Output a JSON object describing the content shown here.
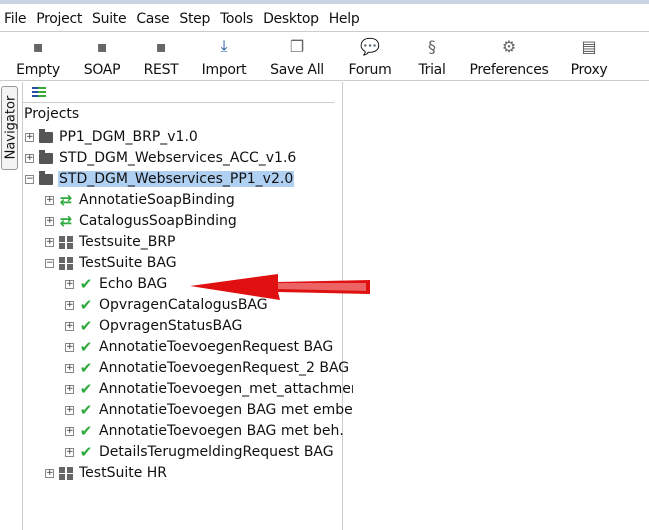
{
  "menu": [
    "File",
    "Project",
    "Suite",
    "Case",
    "Step",
    "Tools",
    "Desktop",
    "Help"
  ],
  "toolbar": [
    {
      "label": "Empty",
      "icon": "empty-project-icon"
    },
    {
      "label": "SOAP",
      "icon": "soap-icon"
    },
    {
      "label": "REST",
      "icon": "rest-icon"
    },
    {
      "label": "Import",
      "icon": "import-icon"
    },
    {
      "label": "Save All",
      "icon": "save-all-icon"
    },
    {
      "label": "Forum",
      "icon": "forum-icon"
    },
    {
      "label": "Trial",
      "icon": "trial-icon"
    },
    {
      "label": "Preferences",
      "icon": "gear-icon"
    },
    {
      "label": "Proxy",
      "icon": "proxy-icon"
    }
  ],
  "navigator": {
    "tab": "Navigator",
    "title": "Projects"
  },
  "tree": [
    {
      "label": "PP1_DGM_BRP_v1.0",
      "level": 0,
      "type": "project",
      "expanded": false
    },
    {
      "label": "STD_DGM_Webservices_ACC_v1.6",
      "level": 0,
      "type": "project",
      "expanded": false
    },
    {
      "label": "STD_DGM_Webservices_PP1_v2.0",
      "level": 0,
      "type": "project",
      "expanded": true,
      "selected": true
    },
    {
      "label": "AnnotatieSoapBinding",
      "level": 1,
      "type": "interface",
      "expanded": false
    },
    {
      "label": "CatalogusSoapBinding",
      "level": 1,
      "type": "interface",
      "expanded": false
    },
    {
      "label": "Testsuite_BRP",
      "level": 1,
      "type": "suite",
      "expanded": false
    },
    {
      "label": "TestSuite BAG",
      "level": 1,
      "type": "suite",
      "expanded": true
    },
    {
      "label": "Echo BAG",
      "level": 2,
      "type": "case",
      "expanded": false
    },
    {
      "label": "OpvragenCatalogusBAG",
      "level": 2,
      "type": "case",
      "expanded": false
    },
    {
      "label": "OpvragenStatusBAG",
      "level": 2,
      "type": "case",
      "expanded": false
    },
    {
      "label": "AnnotatieToevoegenRequest BAG",
      "level": 2,
      "type": "case",
      "expanded": false
    },
    {
      "label": "AnnotatieToevoegenRequest_2 BAG",
      "level": 2,
      "type": "case",
      "expanded": false
    },
    {
      "label": "AnnotatieToevoegen_met_attachment",
      "level": 2,
      "type": "case",
      "expanded": false
    },
    {
      "label": "AnnotatieToevoegen BAG met embedded",
      "level": 2,
      "type": "case",
      "expanded": false
    },
    {
      "label": "AnnotatieToevoegen BAG met beh.",
      "level": 2,
      "type": "case",
      "expanded": false
    },
    {
      "label": "DetailsTerugmeldingRequest BAG",
      "level": 2,
      "type": "case",
      "expanded": false
    },
    {
      "label": "TestSuite HR",
      "level": 1,
      "type": "suite",
      "expanded": false
    }
  ],
  "colors": {
    "selection": "#b0d0f2",
    "check": "#2eaa3c",
    "annotation_arrow": "#e01010"
  }
}
